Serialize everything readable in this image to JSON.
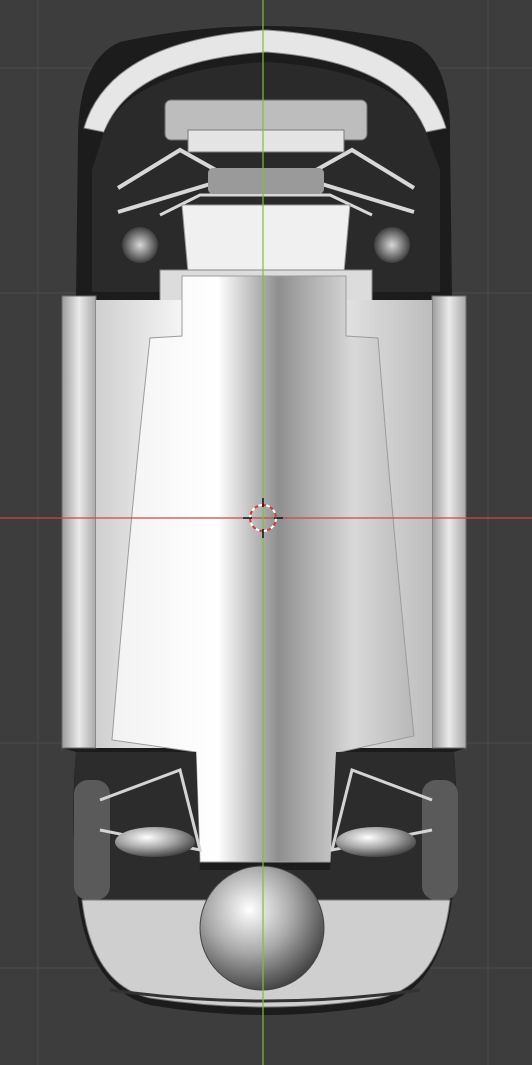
{
  "viewport": {
    "background": "#3d3d3d",
    "grid_color": "#4a4a4a",
    "x_axis_color": "#c84a4a",
    "y_axis_color": "#7fbf3a",
    "cursor_color": "#d23b3b"
  },
  "scene": {
    "object": "car-chassis-underside",
    "shading": "matcap-grey"
  }
}
